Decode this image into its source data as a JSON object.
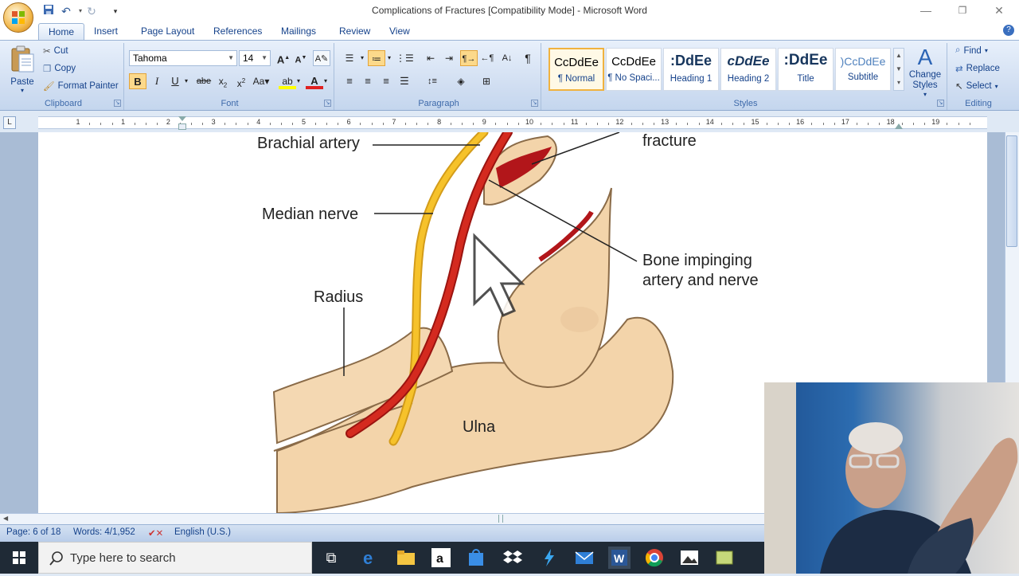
{
  "window": {
    "title": "Complications of Fractures [Compatibility Mode] - Microsoft Word",
    "controls": [
      "minimize-icon",
      "restore-icon",
      "close-icon"
    ]
  },
  "quick_access": [
    "save-icon",
    "undo-icon",
    "redo-icon",
    "customize-icon"
  ],
  "tabs": [
    {
      "label": "Home",
      "active": true
    },
    {
      "label": "Insert"
    },
    {
      "label": "Page Layout"
    },
    {
      "label": "References"
    },
    {
      "label": "Mailings"
    },
    {
      "label": "Review"
    },
    {
      "label": "View"
    }
  ],
  "clipboard": {
    "paste": "Paste",
    "cut": "Cut",
    "copy": "Copy",
    "format_painter": "Format Painter",
    "label": "Clipboard"
  },
  "font": {
    "name": "Tahoma",
    "size": "14",
    "label": "Font"
  },
  "paragraph": {
    "label": "Paragraph"
  },
  "styles": {
    "label": "Styles",
    "tiles": [
      {
        "sample": "CcDdEe",
        "name": "¶ Normal",
        "selected": true
      },
      {
        "sample": "CcDdEe",
        "name": "¶ No Spaci..."
      },
      {
        "sample": ":DdEe",
        "name": "Heading 1"
      },
      {
        "sample": "cDdEe",
        "name": "Heading 2"
      },
      {
        "sample": ":DdEe",
        "name": "Title"
      },
      {
        "sample": ")CcDdEe",
        "name": "Subtitle"
      }
    ],
    "change_styles": "Change Styles"
  },
  "editing": {
    "find": "Find",
    "replace": "Replace",
    "select": "Select",
    "label": "Editing"
  },
  "ruler": {
    "numbers": [
      "1",
      "1",
      "2",
      "3",
      "4",
      "5",
      "6",
      "7",
      "8",
      "9",
      "10",
      "11",
      "12",
      "13",
      "14",
      "15",
      "16",
      "17",
      "18",
      "19"
    ]
  },
  "illustration": {
    "labels": {
      "brachial": "Brachial artery",
      "fracture": "fracture",
      "median": "Median nerve",
      "bone1": "Bone impinging",
      "bone2": "artery and nerve",
      "radius": "Radius",
      "ulna": "Ulna"
    }
  },
  "status": {
    "page": "Page: 6 of 18",
    "words": "Words: 4/1,952",
    "language": "English (U.S.)"
  },
  "taskbar": {
    "search_placeholder": "Type here to search"
  },
  "colors": {
    "artery": "#d42a1f",
    "nerve": "#f6c22b",
    "bone": "#f3d4aa",
    "ribbon": "#cfddf1"
  }
}
